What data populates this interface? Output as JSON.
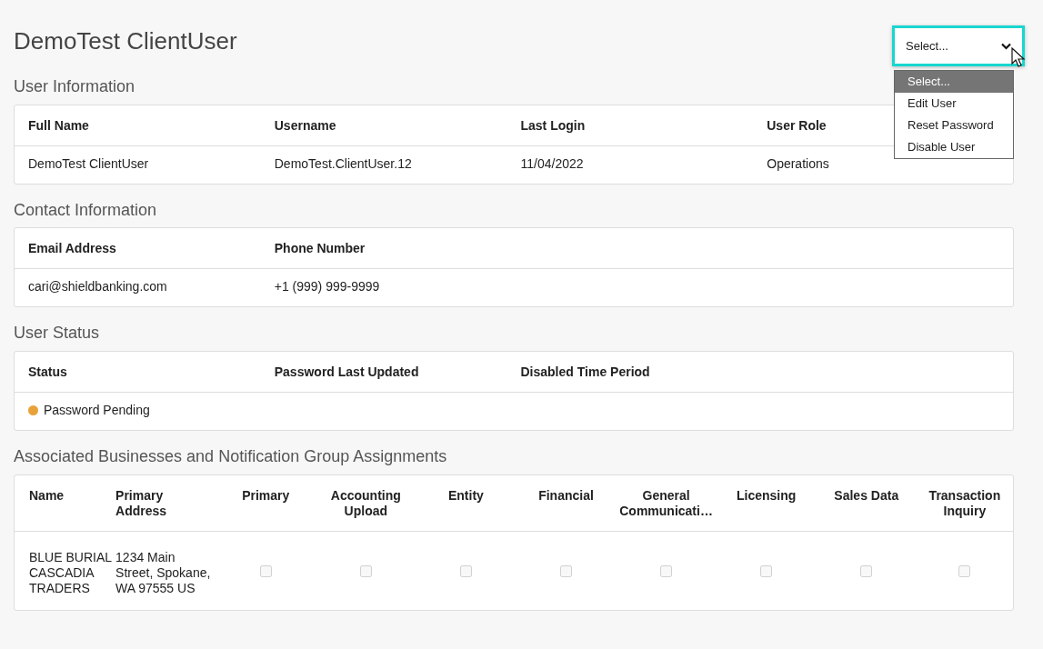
{
  "title": "DemoTest ClientUser",
  "actions": {
    "value": "Select...",
    "open": true,
    "options": [
      {
        "label": "Select...",
        "selected": true
      },
      {
        "label": "Edit User",
        "selected": false
      },
      {
        "label": "Reset Password",
        "selected": false
      },
      {
        "label": "Disable User",
        "selected": false
      }
    ]
  },
  "sections": [
    {
      "heading": "User Information",
      "kind": "info",
      "columns": [
        "Full Name",
        "Username",
        "Last Login",
        "User Role"
      ],
      "rows": [
        {
          "cells": [
            {
              "text": "DemoTest ClientUser"
            },
            {
              "text": "DemoTest.ClientUser.12"
            },
            {
              "text": "11/04/2022"
            },
            {
              "text": "Operations"
            }
          ]
        }
      ]
    },
    {
      "heading": "Contact Information",
      "kind": "info",
      "columns": [
        "Email Address",
        "Phone Number"
      ],
      "rows": [
        {
          "cells": [
            {
              "text": "cari@shieldbanking.com"
            },
            {
              "text": "+1 (999) 999-9999"
            }
          ]
        }
      ]
    },
    {
      "heading": "User Status",
      "kind": "info",
      "columns": [
        "Status",
        "Password Last Updated",
        "Disabled Time Period"
      ],
      "rows": [
        {
          "cells": [
            {
              "kind": "status",
              "text": "Password Pending",
              "color": "#e9a23b"
            }
          ]
        }
      ]
    },
    {
      "heading": "Associated Businesses and Notification Group Assignments",
      "kind": "grid",
      "columns": [
        "Name",
        "Primary Address",
        "Primary",
        "Accounting Upload",
        "Entity",
        "Financial",
        "General Communicati…",
        "Licensing",
        "Sales Data",
        "Transaction Inquiry"
      ],
      "rows": [
        {
          "cells": [
            {
              "text": "BLUE BURIAL CASCADIA TRADERS"
            },
            {
              "text": "1234 Main Street, Spokane, WA 97555 US"
            },
            {
              "kind": "checkbox",
              "checked": false,
              "disabled": true
            },
            {
              "kind": "checkbox",
              "checked": false,
              "disabled": true
            },
            {
              "kind": "checkbox",
              "checked": false,
              "disabled": true
            },
            {
              "kind": "checkbox",
              "checked": false,
              "disabled": true
            },
            {
              "kind": "checkbox",
              "checked": false,
              "disabled": true
            },
            {
              "kind": "checkbox",
              "checked": false,
              "disabled": true
            },
            {
              "kind": "checkbox",
              "checked": false,
              "disabled": true
            },
            {
              "kind": "checkbox",
              "checked": false,
              "disabled": true
            }
          ]
        }
      ]
    }
  ]
}
